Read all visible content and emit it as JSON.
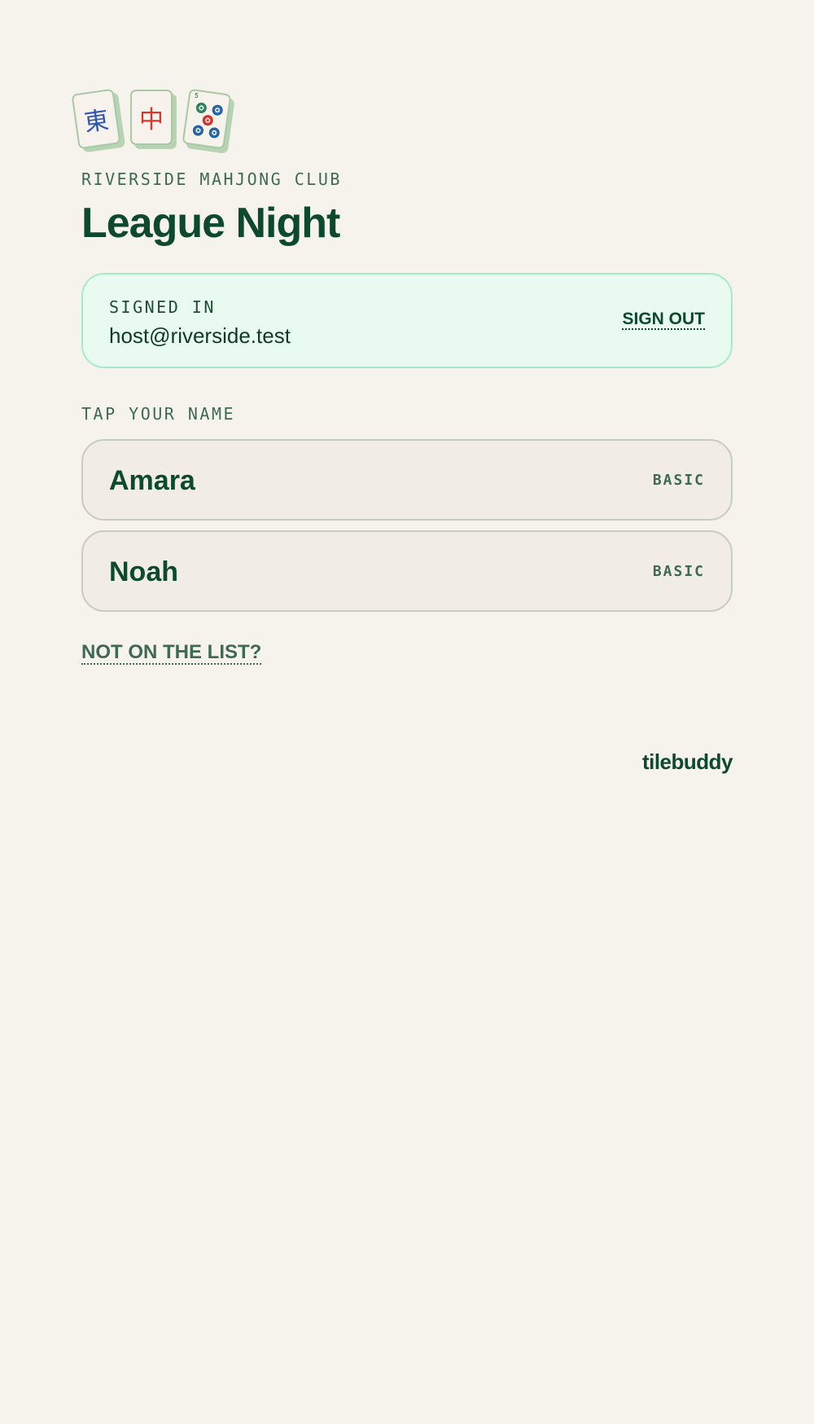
{
  "tiles": [
    {
      "glyph": "東",
      "icon": "mahjong-east-wind-tile-icon"
    },
    {
      "glyph": "中",
      "icon": "mahjong-red-dragon-tile-icon"
    },
    {
      "glyph": "",
      "corner": "5",
      "icon": "mahjong-five-dots-tile-icon"
    }
  ],
  "header": {
    "club_name": "RIVERSIDE MAHJONG CLUB",
    "title": "League Night"
  },
  "signed_in": {
    "label": "SIGNED IN",
    "email": "host@riverside.test",
    "sign_out_label": "SIGN OUT"
  },
  "players": {
    "section_label": "TAP YOUR NAME",
    "items": [
      {
        "name": "Amara",
        "badge": "BASIC"
      },
      {
        "name": "Noah",
        "badge": "BASIC"
      }
    ]
  },
  "not_on_list_label": "NOT ON THE LIST?",
  "brand": "tilebuddy",
  "colors": {
    "background": "#f6f2ec",
    "primary_text": "#0d4a2c",
    "muted_text": "#3e6a52",
    "signed_card_bg": "#e9fbf0",
    "signed_card_border": "#a6ebc8",
    "row_bg": "#f1ece5",
    "row_border": "#c7ccc2"
  }
}
